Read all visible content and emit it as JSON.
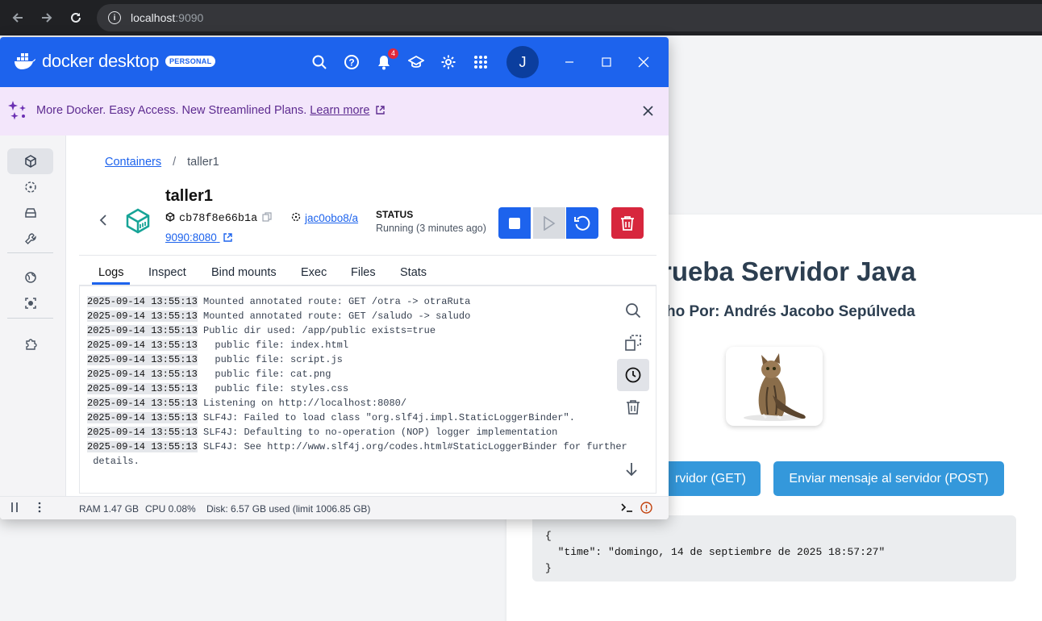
{
  "browser": {
    "url_host": "localhost",
    "url_port": ":9090"
  },
  "webpage": {
    "title": "rueba Servidor Java",
    "subtitle": "ho Por: Andrés Jacobo Sepúlveda",
    "get_button": "rvidor (GET)",
    "post_button": "Enviar mensaje al servidor (POST)",
    "response_text": "{\n  \"time\": \"domingo, 14 de septiembre de 2025 18:57:27\"\n}"
  },
  "docker": {
    "brand": "docker desktop",
    "plan_badge": "PERSONAL",
    "notification_count": "4",
    "avatar_initial": "J",
    "banner": {
      "text": "More Docker. Easy Access. New Streamlined Plans. ",
      "link": "Learn more"
    },
    "breadcrumb": {
      "parent": "Containers",
      "separator": "/",
      "current": "taller1"
    },
    "container": {
      "name": "taller1",
      "id": "cb78f8e66b1a",
      "image": "jac0obo8/a",
      "port": "9090:8080",
      "status_label": "STATUS",
      "status_value": "Running (3 minutes ago)"
    },
    "tabs": [
      "Logs",
      "Inspect",
      "Bind mounts",
      "Exec",
      "Files",
      "Stats"
    ],
    "logs": [
      {
        "ts": "2025-09-14 13:55:13",
        "msg": " Mounted annotated route: GET /otra -> otraRuta"
      },
      {
        "ts": "2025-09-14 13:55:13",
        "msg": " Mounted annotated route: GET /saludo -> saludo"
      },
      {
        "ts": "2025-09-14 13:55:13",
        "msg": " Public dir used: /app/public exists=true"
      },
      {
        "ts": "2025-09-14 13:55:13",
        "msg": "   public file: index.html"
      },
      {
        "ts": "2025-09-14 13:55:13",
        "msg": "   public file: script.js"
      },
      {
        "ts": "2025-09-14 13:55:13",
        "msg": "   public file: cat.png"
      },
      {
        "ts": "2025-09-14 13:55:13",
        "msg": "   public file: styles.css"
      },
      {
        "ts": "2025-09-14 13:55:13",
        "msg": " Listening on http://localhost:8080/"
      },
      {
        "ts": "2025-09-14 13:55:13",
        "msg": " SLF4J: Failed to load class \"org.slf4j.impl.StaticLoggerBinder\"."
      },
      {
        "ts": "2025-09-14 13:55:13",
        "msg": " SLF4J: Defaulting to no-operation (NOP) logger implementation"
      },
      {
        "ts": "2025-09-14 13:55:13",
        "msg": " SLF4J: See http://www.slf4j.org/codes.html#StaticLoggerBinder for further"
      },
      {
        "ts": "",
        "msg": " details."
      }
    ],
    "status_bar": {
      "ram": "RAM 1.47 GB",
      "cpu": "CPU 0.08%",
      "disk": "Disk: 6.57 GB used (limit 1006.85 GB)"
    }
  }
}
